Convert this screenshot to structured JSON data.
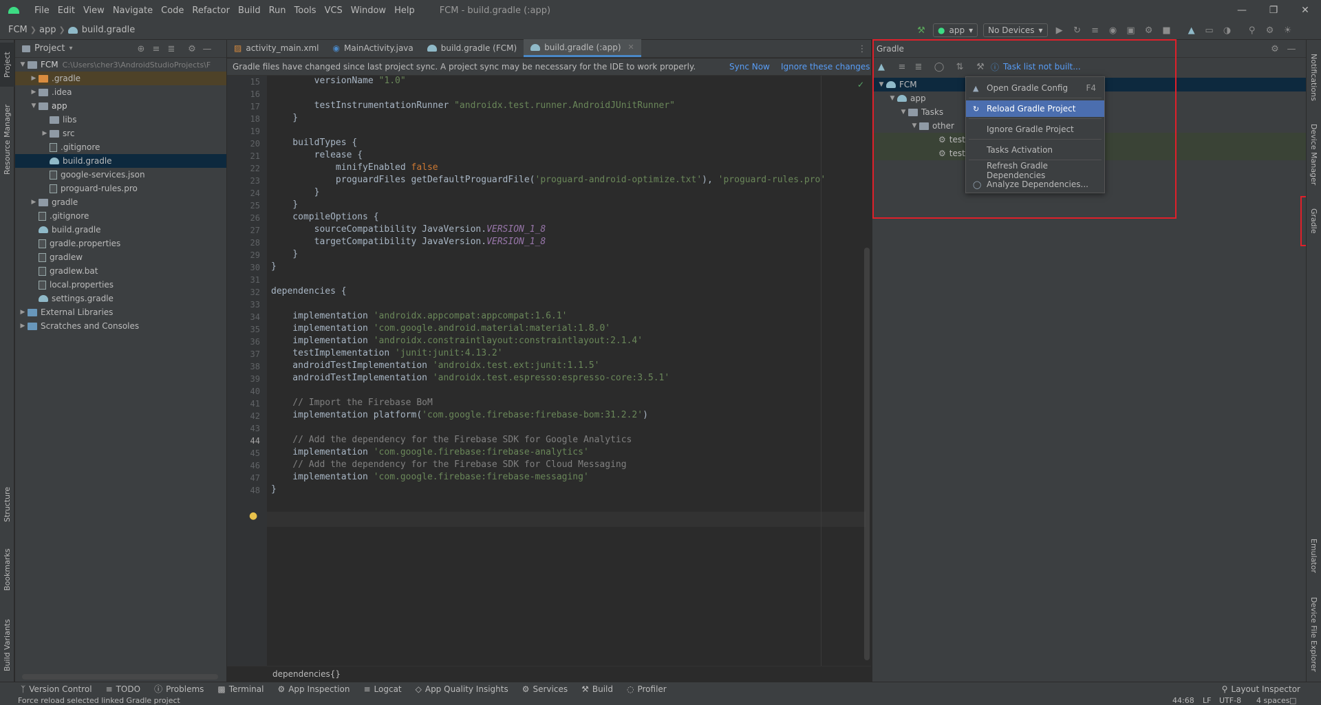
{
  "titlebar": {
    "menus": [
      "File",
      "Edit",
      "View",
      "Navigate",
      "Code",
      "Refactor",
      "Build",
      "Run",
      "Tools",
      "VCS",
      "Window",
      "Help"
    ],
    "title": "FCM - build.gradle (:app)"
  },
  "navbar": {
    "crumbs": [
      "FCM",
      "app",
      "build.gradle"
    ],
    "run_config": "app",
    "device": "No Devices"
  },
  "left_stripe": {
    "project": "Project",
    "resource_manager": "Resource Manager",
    "structure": "Structure",
    "bookmarks": "Bookmarks",
    "build_variants": "Build Variants"
  },
  "project_panel": {
    "title": "Project",
    "root_name": "FCM",
    "root_path": "C:\\Users\\cher3\\AndroidStudioProjects\\F",
    "items": {
      "gradle_dir": ".gradle",
      "idea": ".idea",
      "app": "app",
      "libs": "libs",
      "src": "src",
      "app_gitignore": ".gitignore",
      "app_build_gradle": "build.gradle",
      "google_services": "google-services.json",
      "proguard": "proguard-rules.pro",
      "gradle": "gradle",
      "gitignore": ".gitignore",
      "build_gradle": "build.gradle",
      "gradle_properties": "gradle.properties",
      "gradlew": "gradlew",
      "gradlew_bat": "gradlew.bat",
      "local_properties": "local.properties",
      "settings_gradle": "settings.gradle",
      "external_libraries": "External Libraries",
      "scratches": "Scratches and Consoles"
    }
  },
  "editor": {
    "tabs": [
      "activity_main.xml",
      "MainActivity.java",
      "build.gradle (FCM)",
      "build.gradle (:app)"
    ],
    "notification": "Gradle files have changed since last project sync. A project sync may be necessary for the IDE to work properly.",
    "sync_now": "Sync Now",
    "ignore_changes": "Ignore these changes",
    "line_numbers": [
      "15",
      "16",
      "17",
      "18",
      "19",
      "20",
      "21",
      "22",
      "23",
      "24",
      "25",
      "26",
      "27",
      "28",
      "29",
      "30",
      "31",
      "32",
      "33",
      "34",
      "35",
      "36",
      "37",
      "38",
      "39",
      "40",
      "41",
      "42",
      "43",
      "44",
      "45",
      "46",
      "47",
      "48"
    ],
    "code": {
      "l15a": "        versionName ",
      "l15b": "\"1.0\"",
      "l17a": "        testInstrumentationRunner ",
      "l17b": "\"androidx.test.runner.AndroidJUnitRunner\"",
      "l18": "    }",
      "l20": "    buildTypes {",
      "l21": "        release {",
      "l22a": "            minifyEnabled ",
      "l22b": "false",
      "l23a": "            proguardFiles getDefaultProguardFile(",
      "l23b": "'proguard-android-optimize.txt'",
      "l23c": "), ",
      "l23d": "'proguard-rules.pro'",
      "l24": "        }",
      "l25": "    }",
      "l26": "    compileOptions {",
      "l27a": "        sourceCompatibility JavaVersion.",
      "l27b": "VERSION_1_8",
      "l28a": "        targetCompatibility JavaVersion.",
      "l28b": "VERSION_1_8",
      "l29": "    }",
      "l30": "}",
      "l32": "dependencies {",
      "l34a": "    implementation ",
      "l34b": "'androidx.appcompat:appcompat:1.6.1'",
      "l35a": "    implementation ",
      "l35b": "'com.google.android.material:material:1.8.0'",
      "l36a": "    implementation ",
      "l36b": "'androidx.constraintlayout:constraintlayout:2.1.4'",
      "l37a": "    testImplementation ",
      "l37b": "'junit:junit:4.13.2'",
      "l38a": "    androidTestImplementation ",
      "l38b": "'androidx.test.ext:junit:1.1.5'",
      "l39a": "    androidTestImplementation ",
      "l39b": "'androidx.test.espresso:espresso-core:3.5.1'",
      "l41": "    // Import the Firebase BoM",
      "l42a": "    implementation platform(",
      "l42b": "'com.google.firebase:firebase-bom:31.2.2'",
      "l42c": ")",
      "l44": "    // Add the dependency for the Firebase SDK for Google Analytics",
      "l45a": "    implementation ",
      "l45b": "'com.google.firebase:firebase-analytics'",
      "l46": "    // Add the dependency for the Firebase SDK for Cloud Messaging",
      "l47a": "    implementation ",
      "l47b": "'com.google.firebase:firebase-messaging'",
      "l48": "}"
    },
    "breadcrumb": "dependencies{}"
  },
  "gradle_panel": {
    "title": "Gradle",
    "task_list": "Task list not built...",
    "tree": {
      "root": "FCM",
      "app": "app",
      "tasks": "Tasks",
      "other": "other",
      "test1": "testl",
      "test2": "testl"
    }
  },
  "context_menu": {
    "open_config": "Open Gradle Config",
    "open_config_shortcut": "F4",
    "reload": "Reload Gradle Project",
    "ignore": "Ignore Gradle Project",
    "tasks_activation": "Tasks Activation",
    "refresh_deps": "Refresh Gradle Dependencies",
    "analyze_deps": "Analyze Dependencies..."
  },
  "right_stripe": {
    "notifications": "Notifications",
    "device_manager": "Device Manager",
    "gradle": "Gradle",
    "emulator": "Emulator",
    "device_file_explorer": "Device File Explorer"
  },
  "bottom_tools": [
    "Version Control",
    "TODO",
    "Problems",
    "Terminal",
    "App Inspection",
    "Logcat",
    "App Quality Insights",
    "Services",
    "Build",
    "Profiler"
  ],
  "layout_inspector": "Layout Inspector",
  "status": {
    "message": "Force reload selected linked Gradle project",
    "position": "44:68",
    "line_sep": "LF",
    "encoding": "UTF-8",
    "indent": "4 spaces"
  },
  "colors": {
    "accent": "#4b6eaf",
    "highlight_box": "#e0202a",
    "selection": "#0d293e"
  }
}
